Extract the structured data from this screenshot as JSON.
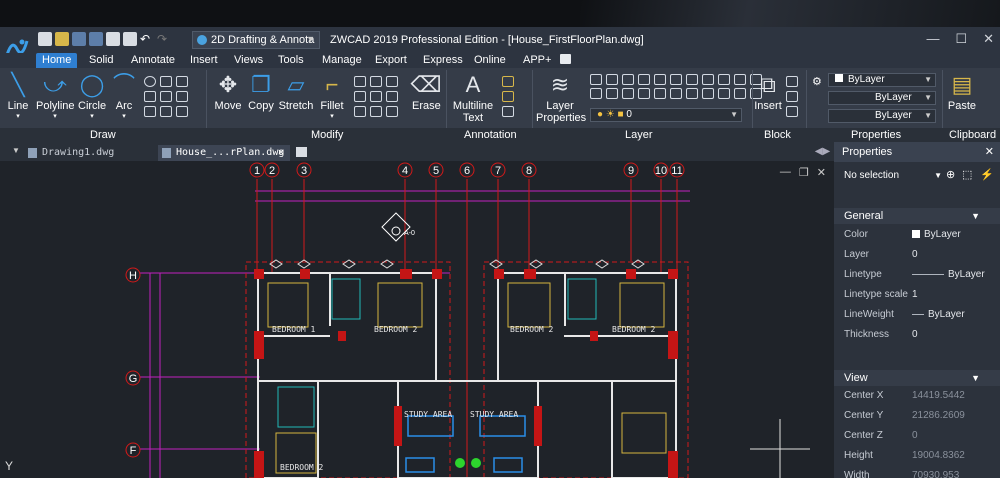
{
  "app": {
    "title": "ZWCAD 2019 Professional Edition - [House_FirstFloorPlan.dwg]",
    "workspace": "2D Drafting & Annota"
  },
  "ribbon_tabs": [
    "Home",
    "Solid",
    "Annotate",
    "Insert",
    "Views",
    "Tools",
    "Manage",
    "Export",
    "Express",
    "Online",
    "APP+"
  ],
  "draw": {
    "line": "Line",
    "polyline": "Polyline",
    "circle": "Circle",
    "arc": "Arc"
  },
  "modify": {
    "move": "Move",
    "copy": "Copy",
    "stretch": "Stretch",
    "fillet": "Fillet",
    "erase": "Erase"
  },
  "annotation": {
    "mtext_line1": "Multiline",
    "mtext_line2": "Text"
  },
  "layer": {
    "props_line1": "Layer",
    "props_line2": "Properties",
    "current": "0"
  },
  "block": {
    "insert": "Insert"
  },
  "properties_ribbon": {
    "color": "ByLayer",
    "linetype": "ByLayer",
    "lineweight": "ByLayer"
  },
  "clipboard": {
    "paste": "Paste"
  },
  "panel_titles": {
    "draw": "Draw",
    "modify": "Modify",
    "annotation": "Annotation",
    "layer": "Layer",
    "block": "Block",
    "properties": "Properties",
    "clipboard": "Clipboard"
  },
  "doc_tabs": [
    "Drawing1.dwg",
    "House_...rPlan.dwg"
  ],
  "props_panel": {
    "title": "Properties",
    "selection": "No selection",
    "general_title": "General",
    "general": [
      {
        "k": "Color",
        "v": "ByLayer"
      },
      {
        "k": "Layer",
        "v": "0"
      },
      {
        "k": "Linetype",
        "v": "ByLayer"
      },
      {
        "k": "Linetype scale",
        "v": "1"
      },
      {
        "k": "LineWeight",
        "v": "ByLayer"
      },
      {
        "k": "Thickness",
        "v": "0"
      }
    ],
    "view_title": "View",
    "view": [
      {
        "k": "Center X",
        "v": "14419.5442"
      },
      {
        "k": "Center Y",
        "v": "21286.2609"
      },
      {
        "k": "Center Z",
        "v": "0"
      },
      {
        "k": "Height",
        "v": "19004.8362"
      },
      {
        "k": "Width",
        "v": "70930.953"
      }
    ]
  },
  "drawing": {
    "grid_top": [
      "1",
      "2",
      "3",
      "4",
      "5",
      "6",
      "7",
      "8",
      "9",
      "10",
      "11"
    ],
    "grid_left": [
      "H",
      "G",
      "F"
    ],
    "room_labels": [
      "BEDROOM 1",
      "BEDROOM 2",
      "STUDY AREA",
      "STUDY AREA",
      "BEDROOM 2",
      "BEDROOM 2",
      "BEDROOM 2"
    ],
    "axis_y": "Y",
    "crosshair_label": "A-0"
  },
  "colors": {
    "accent": "#2f7fd1",
    "ribbon": "#353c48",
    "canvas": "#1f2329"
  }
}
